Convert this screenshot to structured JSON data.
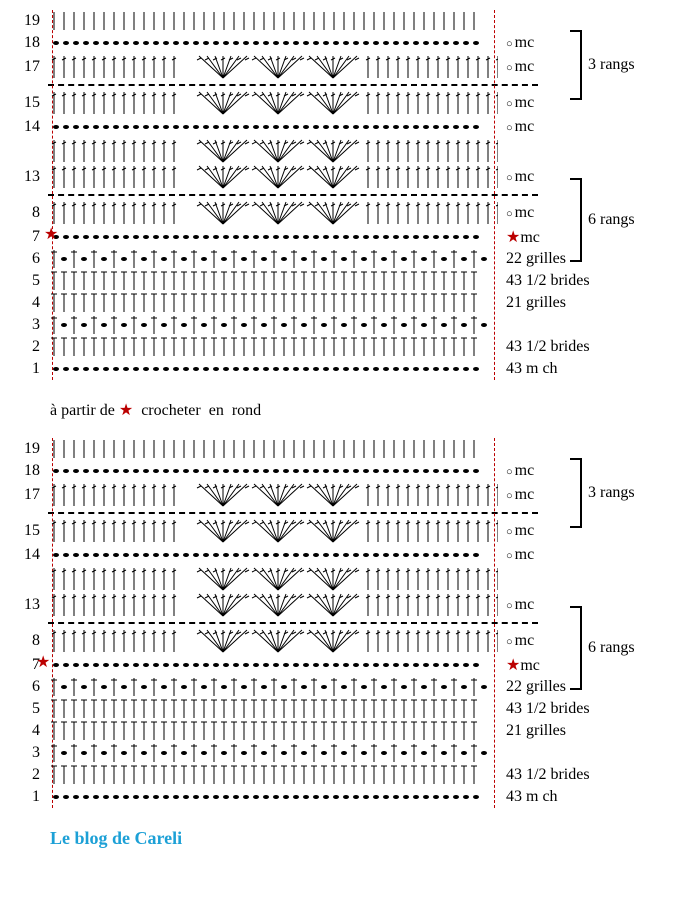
{
  "blocks": [
    {
      "row_numbers_left": [
        "19",
        "18",
        "17",
        "",
        "15",
        "",
        "14",
        "",
        "13",
        "",
        "8",
        "",
        "7",
        "6",
        "5",
        "4",
        "3",
        "2",
        "1"
      ],
      "right_labels": {
        "19": "",
        "18": "mc",
        "17": "mc",
        "dashed_17": "",
        "15": "mc",
        "14": "mc",
        "13": "mc",
        "8": "mc",
        "7": "mc",
        "6": "22 grilles",
        "5": "43 1/2 brides",
        "4": "21 grilles",
        "2": "43 1/2 brides",
        "1": "43 m ch"
      },
      "brackets": [
        {
          "label": "3 rangs",
          "top_row": 18,
          "span_rows": 3
        },
        {
          "label": "6 rangs",
          "top_row": 13,
          "span_rows": 3
        }
      ],
      "instruction": "à partir de ★  crocheter  en  rond"
    },
    {
      "row_numbers_left": [
        "19",
        "18",
        "17",
        "",
        "15",
        "",
        "14",
        "",
        "13",
        "",
        "8",
        "",
        "7",
        "6",
        "5",
        "4",
        "3",
        "2",
        "1"
      ],
      "right_labels": {
        "18": "mc",
        "17": "mc",
        "15": "mc",
        "14": "mc",
        "13": "mc",
        "8": "mc",
        "7": "mc",
        "6": "22 grilles",
        "5": "43 1/2 brides",
        "4": "21 grilles",
        "2": "43 1/2 brides",
        "1": "43 m ch"
      },
      "brackets": [
        {
          "label": "3 rangs",
          "top_row": 18,
          "span_rows": 3
        },
        {
          "label": "6 rangs",
          "top_row": 13,
          "span_rows": 3
        }
      ]
    }
  ],
  "credit": "Le blog de Careli",
  "stitch_types": {
    "chain_row": "row of chain ovals",
    "hdc_row": "row of half double crochets (vertical with slash)",
    "grid_row": "alternating post + chain",
    "cluster_row": "fan clusters (3 angled dc into one)",
    "chain_ovals": "row of chain stitch ovals"
  }
}
